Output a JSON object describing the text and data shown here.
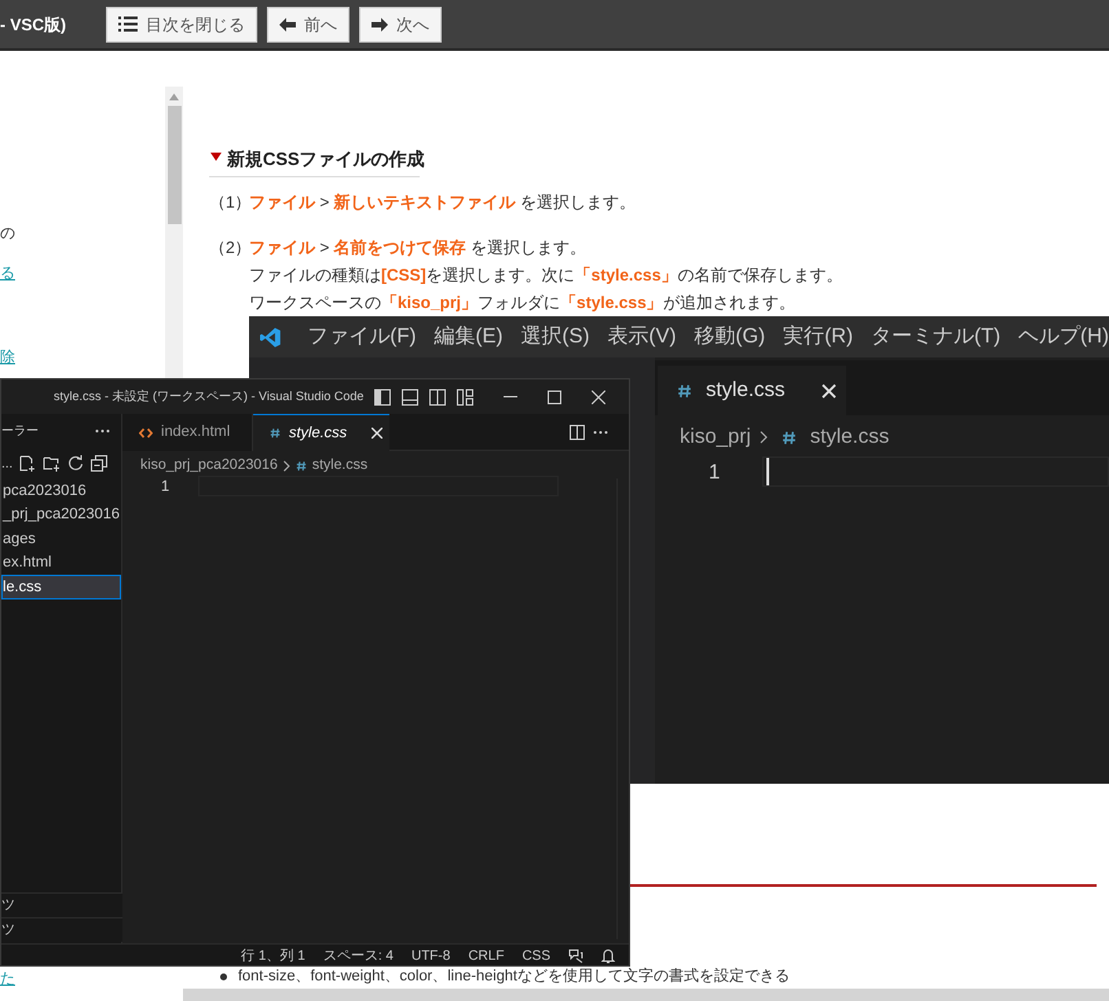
{
  "header": {
    "title": "- VSC版)",
    "buttons": [
      {
        "kind": "toc",
        "label": "目次を閉じる"
      },
      {
        "kind": "prev",
        "label": "前へ"
      },
      {
        "kind": "next",
        "label": "次へ"
      }
    ]
  },
  "sidebar_fragments": [
    {
      "text": "の",
      "link": false
    },
    {
      "text": "る",
      "link": true
    },
    {
      "text": "除",
      "link": true
    },
    {
      "text": "た",
      "link": true
    }
  ],
  "article": {
    "heading": "新規CSSファイルの作成",
    "steps": [
      {
        "number": "（1）",
        "lines": [
          [
            {
              "kind": "accent",
              "text": "ファイル"
            },
            {
              "kind": "plain",
              "text": " > "
            },
            {
              "kind": "accent",
              "text": "新しいテキストファイル"
            },
            {
              "kind": "plain",
              "text": " を選択します。"
            }
          ]
        ]
      },
      {
        "number": "（2）",
        "lines": [
          [
            {
              "kind": "accent",
              "text": "ファイル"
            },
            {
              "kind": "plain",
              "text": " > "
            },
            {
              "kind": "accent",
              "text": "名前をつけて保存"
            },
            {
              "kind": "plain",
              "text": " を選択します。"
            }
          ],
          [
            {
              "kind": "plain",
              "text": "ファイルの種類は"
            },
            {
              "kind": "accent",
              "text": "[CSS]"
            },
            {
              "kind": "plain",
              "text": "を選択します。次に"
            },
            {
              "kind": "accent",
              "text": "「style.css」"
            },
            {
              "kind": "plain",
              "text": "の名前で保存します。"
            }
          ],
          [
            {
              "kind": "plain",
              "text": "ワークスペースの"
            },
            {
              "kind": "accent",
              "text": "「kiso_prj」"
            },
            {
              "kind": "plain",
              "text": "フォルダに"
            },
            {
              "kind": "accent",
              "text": "「style.css」"
            },
            {
              "kind": "plain",
              "text": "が追加されます。"
            }
          ]
        ]
      }
    ],
    "bullet": "font-size、font-weight、color、line-heightなどを使用して文字の書式を設定できる"
  },
  "back_window": {
    "menus": [
      "ファイル(F)",
      "編集(E)",
      "選択(S)",
      "表示(V)",
      "移動(G)",
      "実行(R)",
      "ターミナル(T)",
      "ヘルプ(H)"
    ],
    "tab": "style.css",
    "breadcrumb": [
      "kiso_prj",
      "style.css"
    ],
    "line_number": "1"
  },
  "front_window": {
    "title": "style.css - 未設定 (ワークスペース) - Visual Studio Code",
    "explorer_title": "ーラー",
    "toolbar_fragment": "...",
    "tree": [
      {
        "label": "pca2023016",
        "selected": false
      },
      {
        "label": "_prj_pca2023016",
        "selected": false
      },
      {
        "label": "ages",
        "selected": false
      },
      {
        "label": "ex.html",
        "selected": false
      },
      {
        "label": "le.css",
        "selected": true
      }
    ],
    "sections": [
      "ツ",
      "ツ"
    ],
    "tabs": [
      {
        "kind": "html",
        "label": "index.html",
        "selected": false
      },
      {
        "kind": "css",
        "label": "style.css",
        "selected": true
      }
    ],
    "breadcrumb": [
      "kiso_prj_pca2023016",
      "style.css"
    ],
    "line_number": "1",
    "status": [
      "行 1、列 1",
      "スペース: 4",
      "UTF-8",
      "CRLF",
      "CSS"
    ]
  }
}
